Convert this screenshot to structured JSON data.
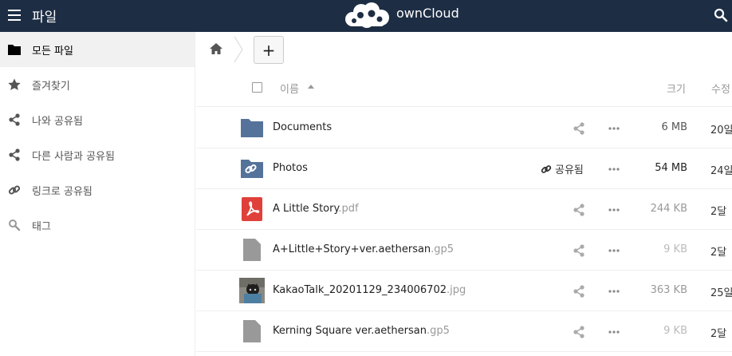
{
  "header": {
    "app_title": "파일",
    "brand": "ownCloud",
    "colors": {
      "header_bg": "#1d2d44",
      "folder": "#55739a",
      "pdf": "#e0403a",
      "generic_file": "#999999"
    }
  },
  "sidebar": {
    "items": [
      {
        "label": "모든 파일",
        "icon": "folder-icon",
        "active": true
      },
      {
        "label": "즐겨찾기",
        "icon": "star-icon"
      },
      {
        "label": "나와 공유됨",
        "icon": "share-icon"
      },
      {
        "label": "다른 사람과 공유됨",
        "icon": "share-icon"
      },
      {
        "label": "링크로 공유됨",
        "icon": "link-icon"
      },
      {
        "label": "태그",
        "icon": "tag-search-icon"
      }
    ]
  },
  "controls": {
    "new_label": "+"
  },
  "table": {
    "columns": {
      "name": "이름",
      "size": "크기",
      "modified": "수정"
    },
    "rows": [
      {
        "name": "Documents",
        "ext": "",
        "type": "folder",
        "size": "6 MB",
        "modified": "20일",
        "size_color": "#555"
      },
      {
        "name": "Photos",
        "ext": "",
        "type": "shared-folder",
        "shared_label": "공유됨",
        "size": "54 MB",
        "modified": "24일",
        "size_color": "#222"
      },
      {
        "name": "A Little Story",
        "ext": ".pdf",
        "type": "pdf",
        "size": "244 KB",
        "modified": "2달",
        "size_color": "#999"
      },
      {
        "name": "A+Little+Story+ver.aethersan",
        "ext": ".gp5",
        "type": "file",
        "size": "9 KB",
        "modified": "2달",
        "size_color": "#bbb"
      },
      {
        "name": "KakaoTalk_20201129_234006702",
        "ext": ".jpg",
        "type": "image",
        "size": "363 KB",
        "modified": "25일",
        "size_color": "#999"
      },
      {
        "name": "Kerning Square ver.aethersan",
        "ext": ".gp5",
        "type": "file",
        "size": "9 KB",
        "modified": "2달",
        "size_color": "#bbb"
      }
    ]
  }
}
